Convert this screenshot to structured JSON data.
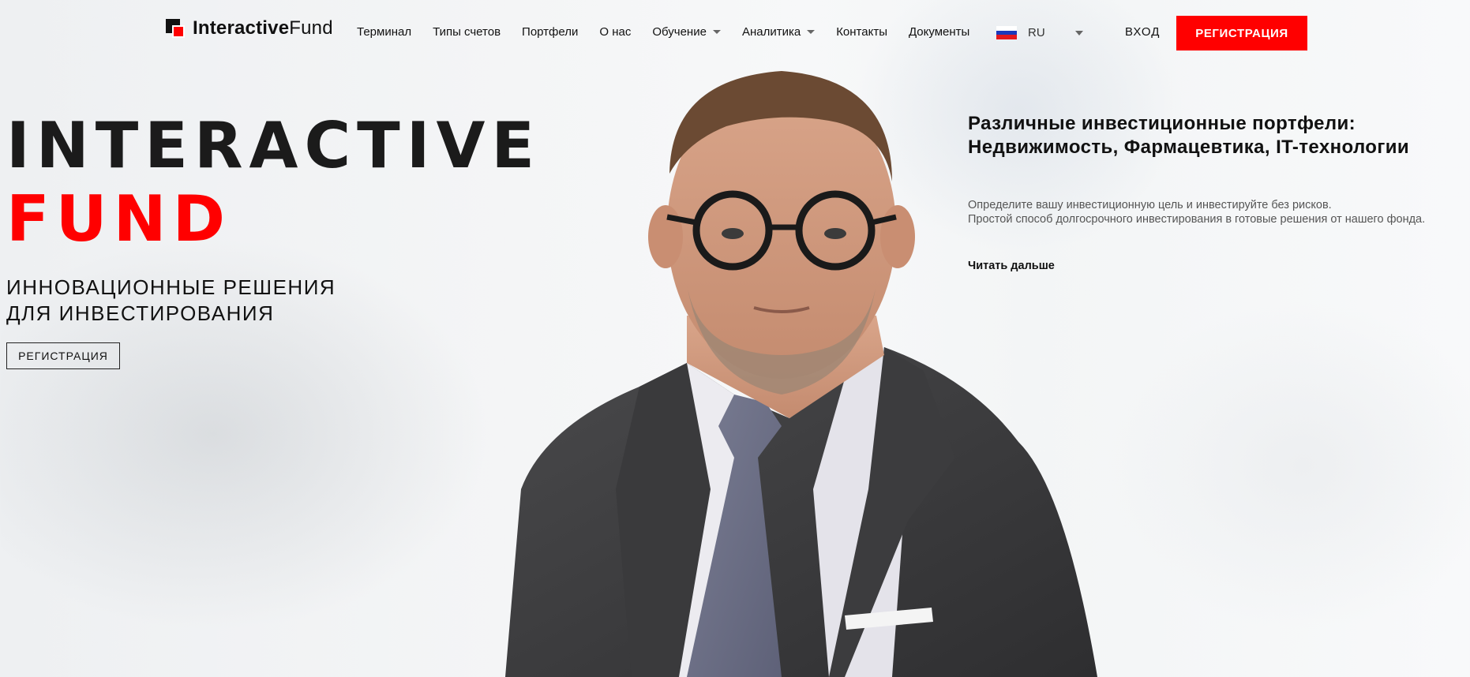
{
  "header": {
    "logo": {
      "bold": "Interactive",
      "light": "Fund"
    },
    "nav": [
      {
        "label": "Терминал"
      },
      {
        "label": "Типы счетов"
      },
      {
        "label": "Портфели"
      },
      {
        "label": "О нас"
      },
      {
        "label": "Обучение",
        "dropdown": true
      },
      {
        "label": "Аналитика",
        "dropdown": true
      },
      {
        "label": "Контакты"
      },
      {
        "label": "Документы"
      }
    ],
    "language": {
      "code": "RU",
      "flag_icon": "russia-flag-icon"
    },
    "login_label": "ВХОД",
    "register_label": "РЕГИСТРАЦИЯ"
  },
  "hero": {
    "title_line1": "INTERACTIVE",
    "title_line2": "FUND",
    "subtitle_line1": "ИННОВАЦИОННЫЕ РЕШЕНИЯ",
    "subtitle_line2": "ДЛЯ ИНВЕСТИРОВАНИЯ",
    "button_label": "РЕГИСТРАЦИЯ"
  },
  "promo": {
    "title": "Различные инвестиционные портфели: Недвижимость, Фармацевтика, IT-технологии",
    "desc_line1": "Определите вашу инвестиционную цель и инвестируйте без рисков.",
    "desc_line2": "Простой способ долгосрочного инвестирования в готовые решения от нашего фонда.",
    "link_label": "Читать дальше"
  },
  "colors": {
    "accent": "#ff0000",
    "text": "#111111",
    "muted": "#555555"
  }
}
